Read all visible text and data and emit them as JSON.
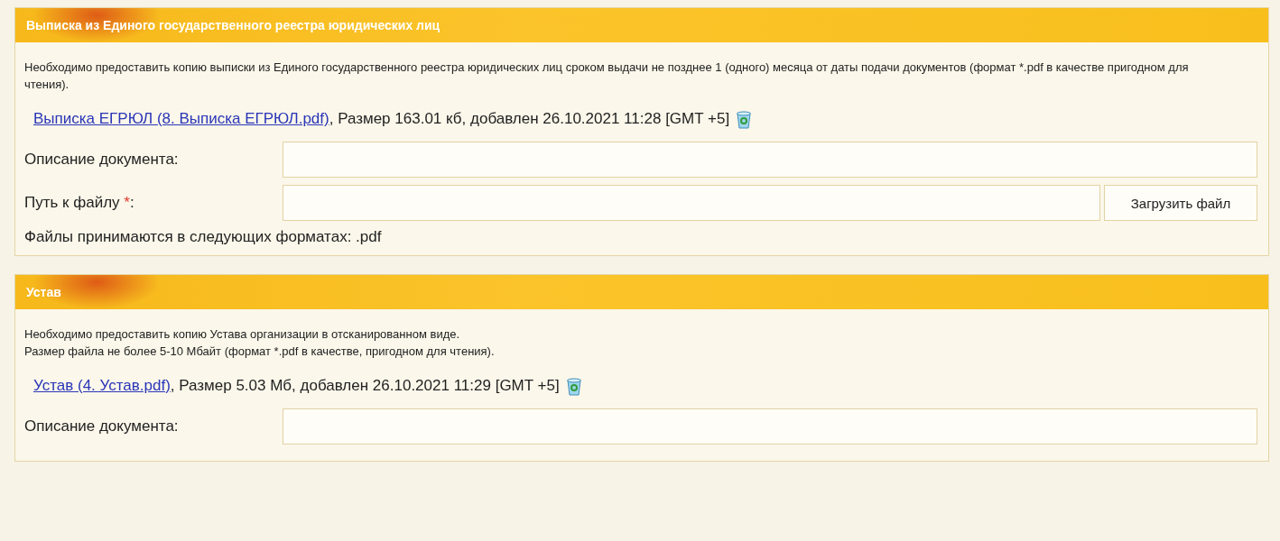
{
  "sections": [
    {
      "title": "Выписка из Единого государственного реестра юридических лиц",
      "paragraphs": [
        "Необходимо предоставить копию выписки из Единого государственного реестра юридических лиц сроком выдачи не позднее 1 (одного) месяца от даты подачи документов (формат *.pdf в качестве пригодном для чтения)."
      ],
      "attachment": {
        "link": "Выписка ЕГРЮЛ (8. Выписка ЕГРЮЛ.pdf)",
        "info": ", Размер 163.01 кб, добавлен 26.10.2021 11:28 [GMT +5]"
      },
      "fields": [
        {
          "kind": "text",
          "label": "Описание документа:"
        },
        {
          "kind": "file",
          "label": "Путь к файлу",
          "required_mark": "*",
          "label_end": ":",
          "button": "Загрузить файл"
        }
      ],
      "formats_note": "Файлы принимаются в следующих форматах: .pdf"
    },
    {
      "title": "Устав",
      "paragraphs": [
        "Необходимо предоставить копию Устава организации в отсканированном виде.",
        "Размер файла не более 5-10 Мбайт (формат *.pdf в качестве, пригодном для чтения)."
      ],
      "attachment": {
        "link": "Устав (4. Устав.pdf)",
        "info": ", Размер 5.03 Мб, добавлен 26.10.2021 11:29 [GMT +5]"
      },
      "fields": [
        {
          "kind": "text",
          "label": "Описание документа:"
        }
      ]
    }
  ]
}
